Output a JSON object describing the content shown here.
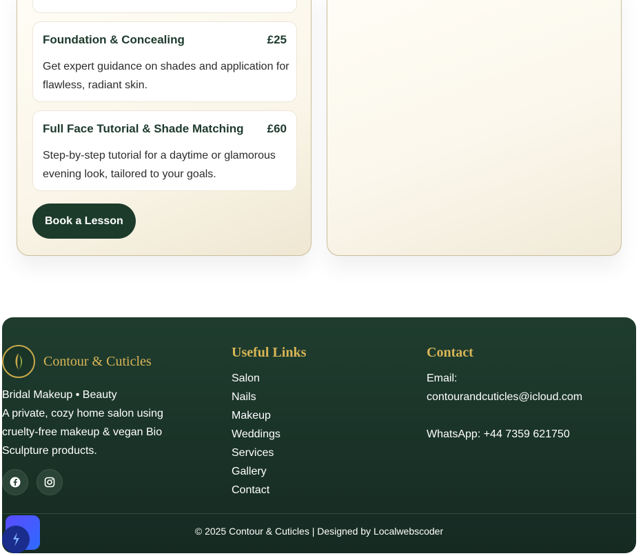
{
  "services": [
    {
      "title": "Foundation & Concealing",
      "price": "£25",
      "description": "Get expert guidance on shades and application for flawless, radiant skin."
    },
    {
      "title": "Full Face Tutorial & Shade Matching",
      "price": "£60",
      "description": "Step-by-step tutorial for a daytime or glamorous evening look, tailored to your goals."
    }
  ],
  "book_button": "Book a Lesson",
  "footer": {
    "brand_name": "Contour & Cuticles",
    "tagline": "Bridal Makeup • Beauty",
    "about": "A private, cozy home salon using cruelty-free makeup & vegan Bio Sculpture products.",
    "social": [
      {
        "icon": "facebook-icon"
      },
      {
        "icon": "instagram-icon"
      }
    ],
    "links_heading": "Useful Links",
    "links": [
      "Salon",
      "Nails",
      "Makeup",
      "Weddings",
      "Services",
      "Gallery",
      "Contact"
    ],
    "contact_heading": "Contact",
    "email_label": "Email:",
    "email": "contourandcuticles@icloud.com",
    "whatsapp": "WhatsApp: +44 7359 621750",
    "copyright": "© 2025 Contour & Cuticles | Designed by Localwebscoder"
  },
  "colors": {
    "brand_green": "#1c3b2b",
    "gold": "#d8b556"
  }
}
